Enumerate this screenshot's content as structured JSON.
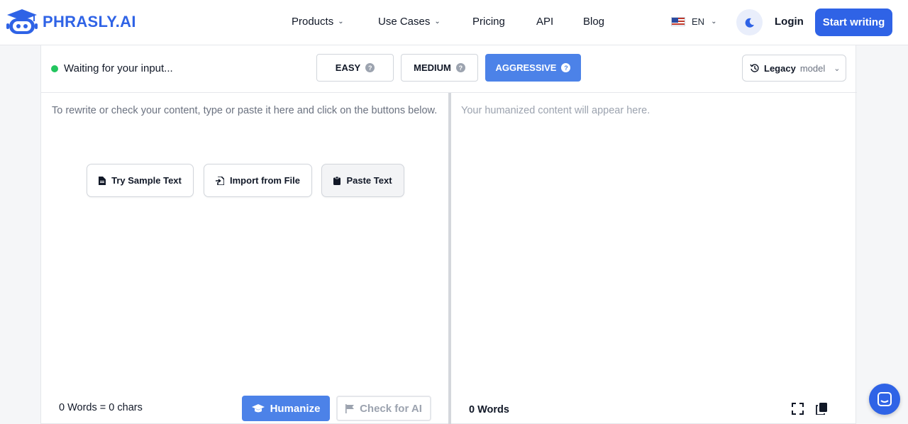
{
  "nav": {
    "logo_text": "PHRASLY.AI",
    "items": [
      {
        "label": "Products",
        "has_dropdown": true
      },
      {
        "label": "Use Cases",
        "has_dropdown": true
      },
      {
        "label": "Pricing",
        "has_dropdown": false
      },
      {
        "label": "API",
        "has_dropdown": false
      },
      {
        "label": "Blog",
        "has_dropdown": false
      }
    ],
    "language": "EN",
    "login": "Login",
    "start": "Start writing"
  },
  "toolbar": {
    "status": "Waiting for your input...",
    "modes": [
      {
        "label": "EASY",
        "active": false
      },
      {
        "label": "MEDIUM",
        "active": false
      },
      {
        "label": "AGGRESSIVE",
        "active": true
      }
    ],
    "model_label": "Legacy",
    "model_sub": "model"
  },
  "input": {
    "placeholder": "To rewrite or check your content, type or paste it here and click on the buttons below.",
    "actions": [
      "Try Sample Text",
      "Import from File",
      "Paste Text"
    ],
    "count_words": "0",
    "count_words_label": "Words =",
    "count_chars": "0",
    "count_chars_label": "chars",
    "humanize": "Humanize",
    "check": "Check for AI"
  },
  "output": {
    "placeholder": "Your humanized content will appear here.",
    "count": "0 Words"
  },
  "colors": {
    "accent": "#2f63e6",
    "mode_active": "#4c82e8",
    "status_dot": "#22c55e"
  }
}
